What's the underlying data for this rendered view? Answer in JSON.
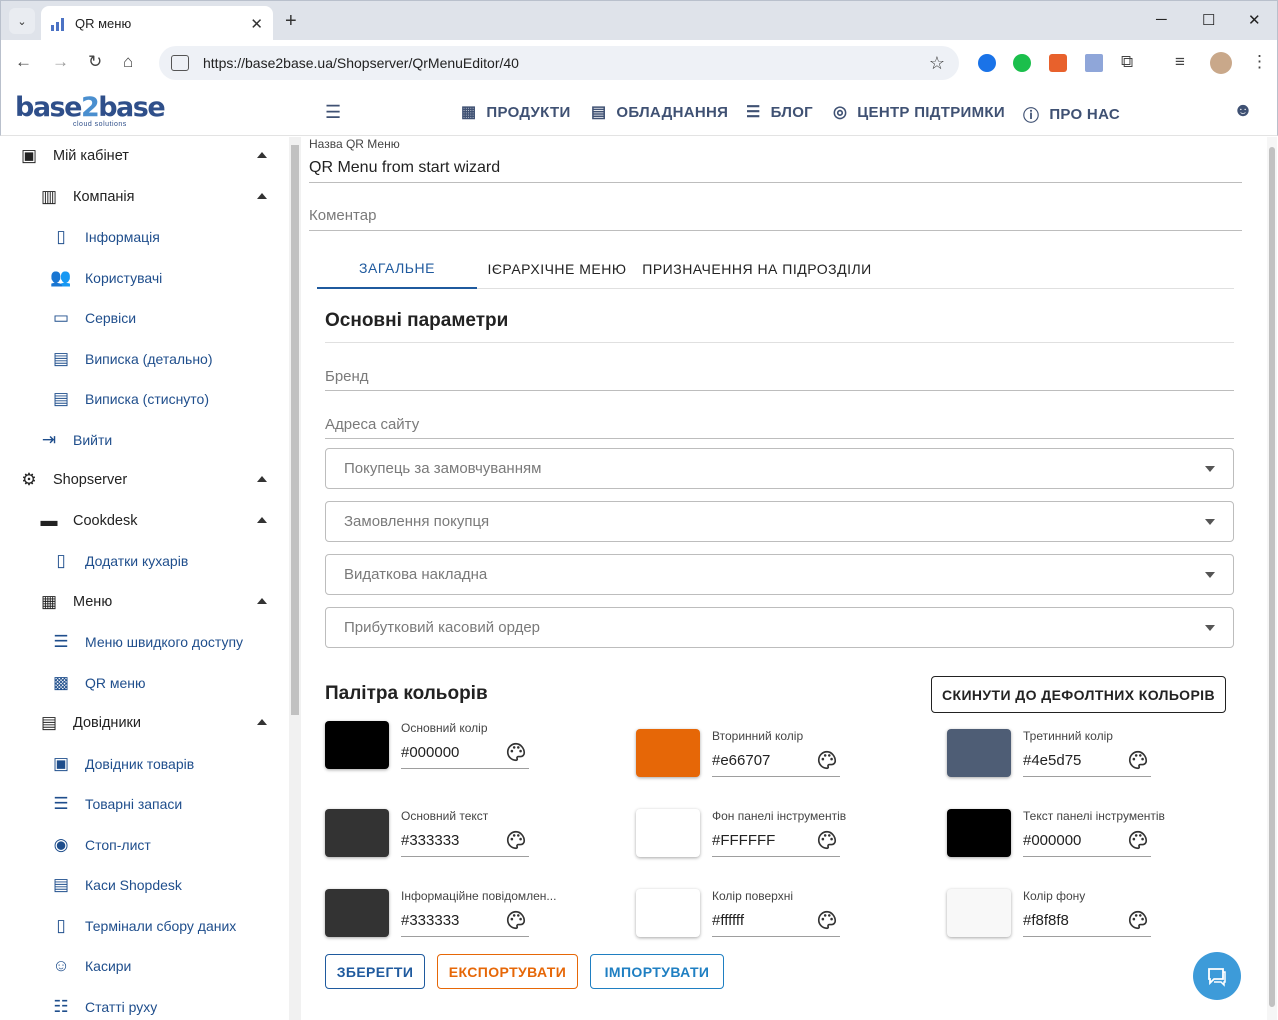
{
  "browser": {
    "tab_title": "QR меню",
    "url": "https://base2base.ua/Shopserver/QrMenuEditor/40"
  },
  "header": {
    "logo_text_a": "base",
    "logo_text_b": "2",
    "logo_text_c": "base",
    "logo_sub": "cloud solutions",
    "nav": [
      {
        "label": "ПРОДУКТИ",
        "icon": "grid-icon"
      },
      {
        "label": "ОБЛАДНАННЯ",
        "icon": "cash-register-icon"
      },
      {
        "label": "БЛОГ",
        "icon": "document-icon"
      },
      {
        "label": "ЦЕНТР ПІДТРИМКИ",
        "icon": "lifebuoy-icon"
      },
      {
        "label": "ПРО НАС",
        "icon": "info-icon"
      }
    ]
  },
  "sidebar": {
    "items": [
      {
        "label": "Мій кабінет",
        "icon": "account-box-icon"
      },
      {
        "label": "Компанія",
        "icon": "building-icon"
      },
      {
        "label": "Інформація",
        "icon": "info-doc-icon"
      },
      {
        "label": "Користувачі",
        "icon": "users-icon"
      },
      {
        "label": "Сервіси",
        "icon": "monitor-icon"
      },
      {
        "label": "Виписка (детально)",
        "icon": "document-icon"
      },
      {
        "label": "Виписка (стиснуто)",
        "icon": "document-icon"
      },
      {
        "label": "Вийти",
        "icon": "logout-icon"
      },
      {
        "label": "Shopserver",
        "icon": "server-icon"
      },
      {
        "label": "Cookdesk",
        "icon": "cookdesk-icon"
      },
      {
        "label": "Додатки кухарів",
        "icon": "tablet-icon"
      },
      {
        "label": "Меню",
        "icon": "grid-icon"
      },
      {
        "label": "Меню швидкого доступу",
        "icon": "burger-icon"
      },
      {
        "label": "QR меню",
        "icon": "qr-icon"
      },
      {
        "label": "Довідники",
        "icon": "book-icon"
      },
      {
        "label": "Довідник товарів",
        "icon": "catalog-icon"
      },
      {
        "label": "Товарні запаси",
        "icon": "stock-icon"
      },
      {
        "label": "Стоп-лист",
        "icon": "stop-icon"
      },
      {
        "label": "Каси Shopdesk",
        "icon": "register-icon"
      },
      {
        "label": "Термінали сбору даних",
        "icon": "terminal-icon"
      },
      {
        "label": "Касири",
        "icon": "cashier-icon"
      },
      {
        "label": "Статті руху",
        "icon": "list-check-icon"
      }
    ]
  },
  "form": {
    "name_label": "Назва QR Меню",
    "name_value": "QR Menu from start wizard",
    "comment_placeholder": "Коментар"
  },
  "tabs": [
    "ЗАГАЛЬНЕ",
    "ІЄРАРХІЧНЕ МЕНЮ",
    "ПРИЗНАЧЕННЯ НА ПІДРОЗДІЛИ"
  ],
  "general": {
    "title": "Основні параметри",
    "brand_placeholder": "Бренд",
    "site_placeholder": "Адреса сайту",
    "selects": [
      "Покупець за замовчуванням",
      "Замовлення покупця",
      "Видаткова накладна",
      "Прибутковий касовий ордер"
    ]
  },
  "palette": {
    "title": "Палітра кольорів",
    "reset_label": "СКИНУТИ ДО ДЕФОЛТНИХ КОЛЬОРІВ",
    "colors": [
      {
        "label": "Основний колір",
        "value": "#000000",
        "swatch": "#000000"
      },
      {
        "label": "Вторинний колір",
        "value": "#e66707",
        "swatch": "#e66707"
      },
      {
        "label": "Третинний колір",
        "value": "#4e5d75",
        "swatch": "#4e5d75"
      },
      {
        "label": "Основний текст",
        "value": "#333333",
        "swatch": "#333333"
      },
      {
        "label": "Фон панелі інструментів",
        "value": "#FFFFFF",
        "swatch": "#FFFFFF"
      },
      {
        "label": "Текст панелі інструментів",
        "value": "#000000",
        "swatch": "#000000"
      },
      {
        "label": "Інформаційне повідомлен...",
        "value": "#333333",
        "swatch": "#333333"
      },
      {
        "label": "Колір поверхні",
        "value": "#ffffff",
        "swatch": "#ffffff"
      },
      {
        "label": "Колір фону",
        "value": "#f8f8f8",
        "swatch": "#f8f8f8"
      }
    ]
  },
  "actions": {
    "save": "ЗБЕРЕГТИ",
    "export": "ЕКСПОРТУВАТИ",
    "import": "ІМПОРТУВАТИ"
  },
  "colors": {
    "primary_link": "#1f4e8c",
    "accent_orange": "#e66707",
    "accent_blue": "#1f7fc2"
  }
}
